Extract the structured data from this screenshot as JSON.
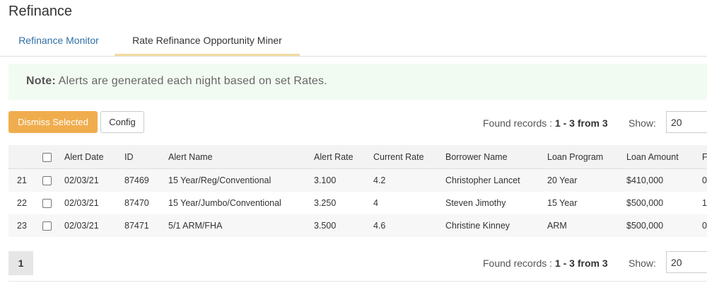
{
  "page": {
    "title": "Refinance"
  },
  "tabs": [
    {
      "label": "Refinance Monitor"
    },
    {
      "label": "Rate Refinance Opportunity Miner"
    }
  ],
  "note": {
    "label": "Note:",
    "text": "Alerts are generated each night based on set Rates."
  },
  "toolbar": {
    "dismiss_label": "Dismiss Selected",
    "config_label": "Config"
  },
  "records": {
    "found_prefix": "Found records :",
    "found_range": "1 - 3 from 3",
    "show_label": "Show:",
    "show_value": "20"
  },
  "table": {
    "columns": [
      "",
      "",
      "Alert Date",
      "ID",
      "Alert Name",
      "Alert Rate",
      "Current Rate",
      "Borrower Name",
      "Loan Program",
      "Loan Amount",
      "F"
    ],
    "rows": [
      {
        "num": "21",
        "date": "02/03/21",
        "id": "87469",
        "name": "15 Year/Reg/Conventional",
        "alert_rate": "3.100",
        "current_rate": "4.2",
        "borrower": "Christopher Lancet",
        "program": "20 Year",
        "amount": "$410,000",
        "extra": "0"
      },
      {
        "num": "22",
        "date": "02/03/21",
        "id": "87470",
        "name": "15 Year/Jumbo/Conventional",
        "alert_rate": "3.250",
        "current_rate": "4",
        "borrower": "Steven Jimothy",
        "program": "15 Year",
        "amount": "$500,000",
        "extra": "1"
      },
      {
        "num": "23",
        "date": "02/03/21",
        "id": "87471",
        "name": "5/1 ARM/FHA",
        "alert_rate": "3.500",
        "current_rate": "4.6",
        "borrower": "Christine Kinney",
        "program": "ARM",
        "amount": "$500,000",
        "extra": "0"
      }
    ]
  },
  "pagination": {
    "current_page": "1"
  },
  "colors": {
    "accent": "#f0ad4e",
    "link": "#2f6fa6",
    "note_bg": "#f2fbf2"
  }
}
